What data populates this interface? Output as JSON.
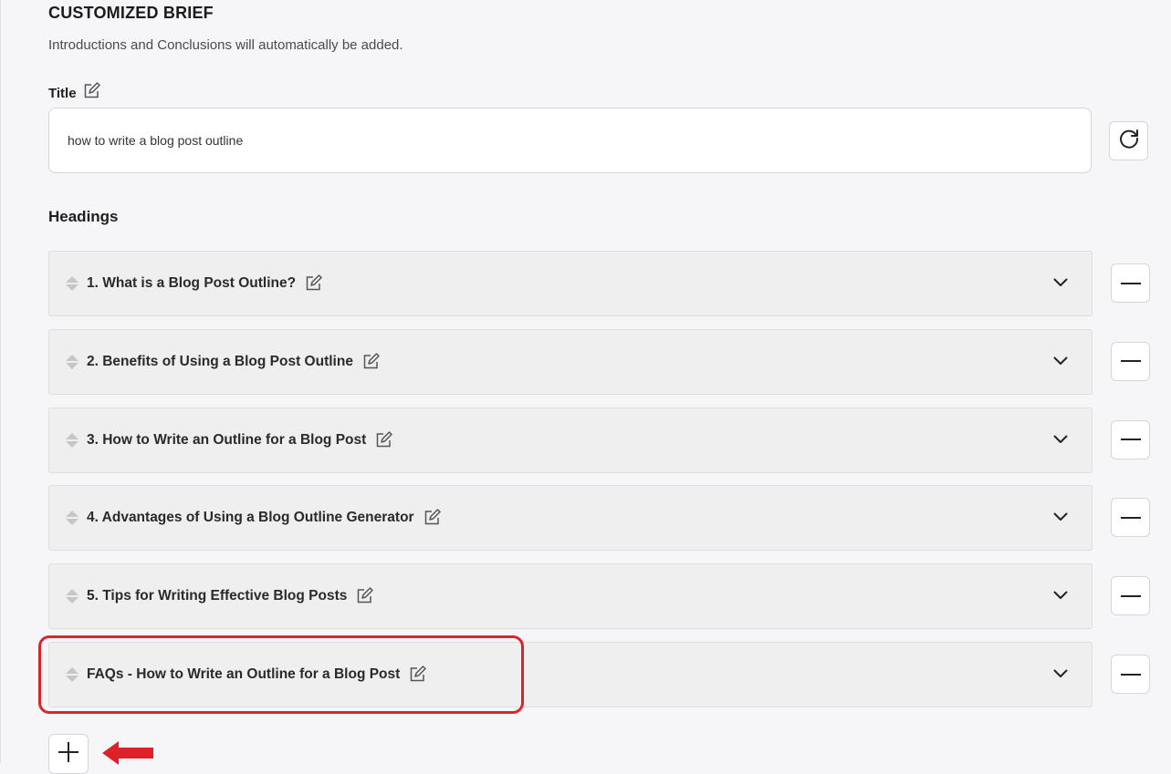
{
  "brief": {
    "heading": "CUSTOMIZED BRIEF",
    "subtitle": "Introductions and Conclusions will automatically be added."
  },
  "title_field": {
    "label": "Title",
    "value": "how to write a blog post outline"
  },
  "headings": {
    "label": "Headings",
    "items": [
      {
        "label": "1. What is a Blog Post Outline?"
      },
      {
        "label": "2. Benefits of Using a Blog Post Outline"
      },
      {
        "label": "3. How to Write an Outline for a Blog Post"
      },
      {
        "label": "4. Advantages of Using a Blog Outline Generator"
      },
      {
        "label": "5. Tips for Writing Effective Blog Posts"
      },
      {
        "label": "FAQs - How to Write an Outline for a Blog Post"
      }
    ]
  },
  "icons": {
    "edit": "edit-icon",
    "refresh": "refresh-icon",
    "drag": "drag-handle-icon",
    "expand": "chevron-down-icon",
    "remove": "minus-icon",
    "add": "plus-icon",
    "annotation_arrow": "arrow-left-icon"
  },
  "colors": {
    "annotation": "#d9262e",
    "row_background": "#efeff0"
  }
}
